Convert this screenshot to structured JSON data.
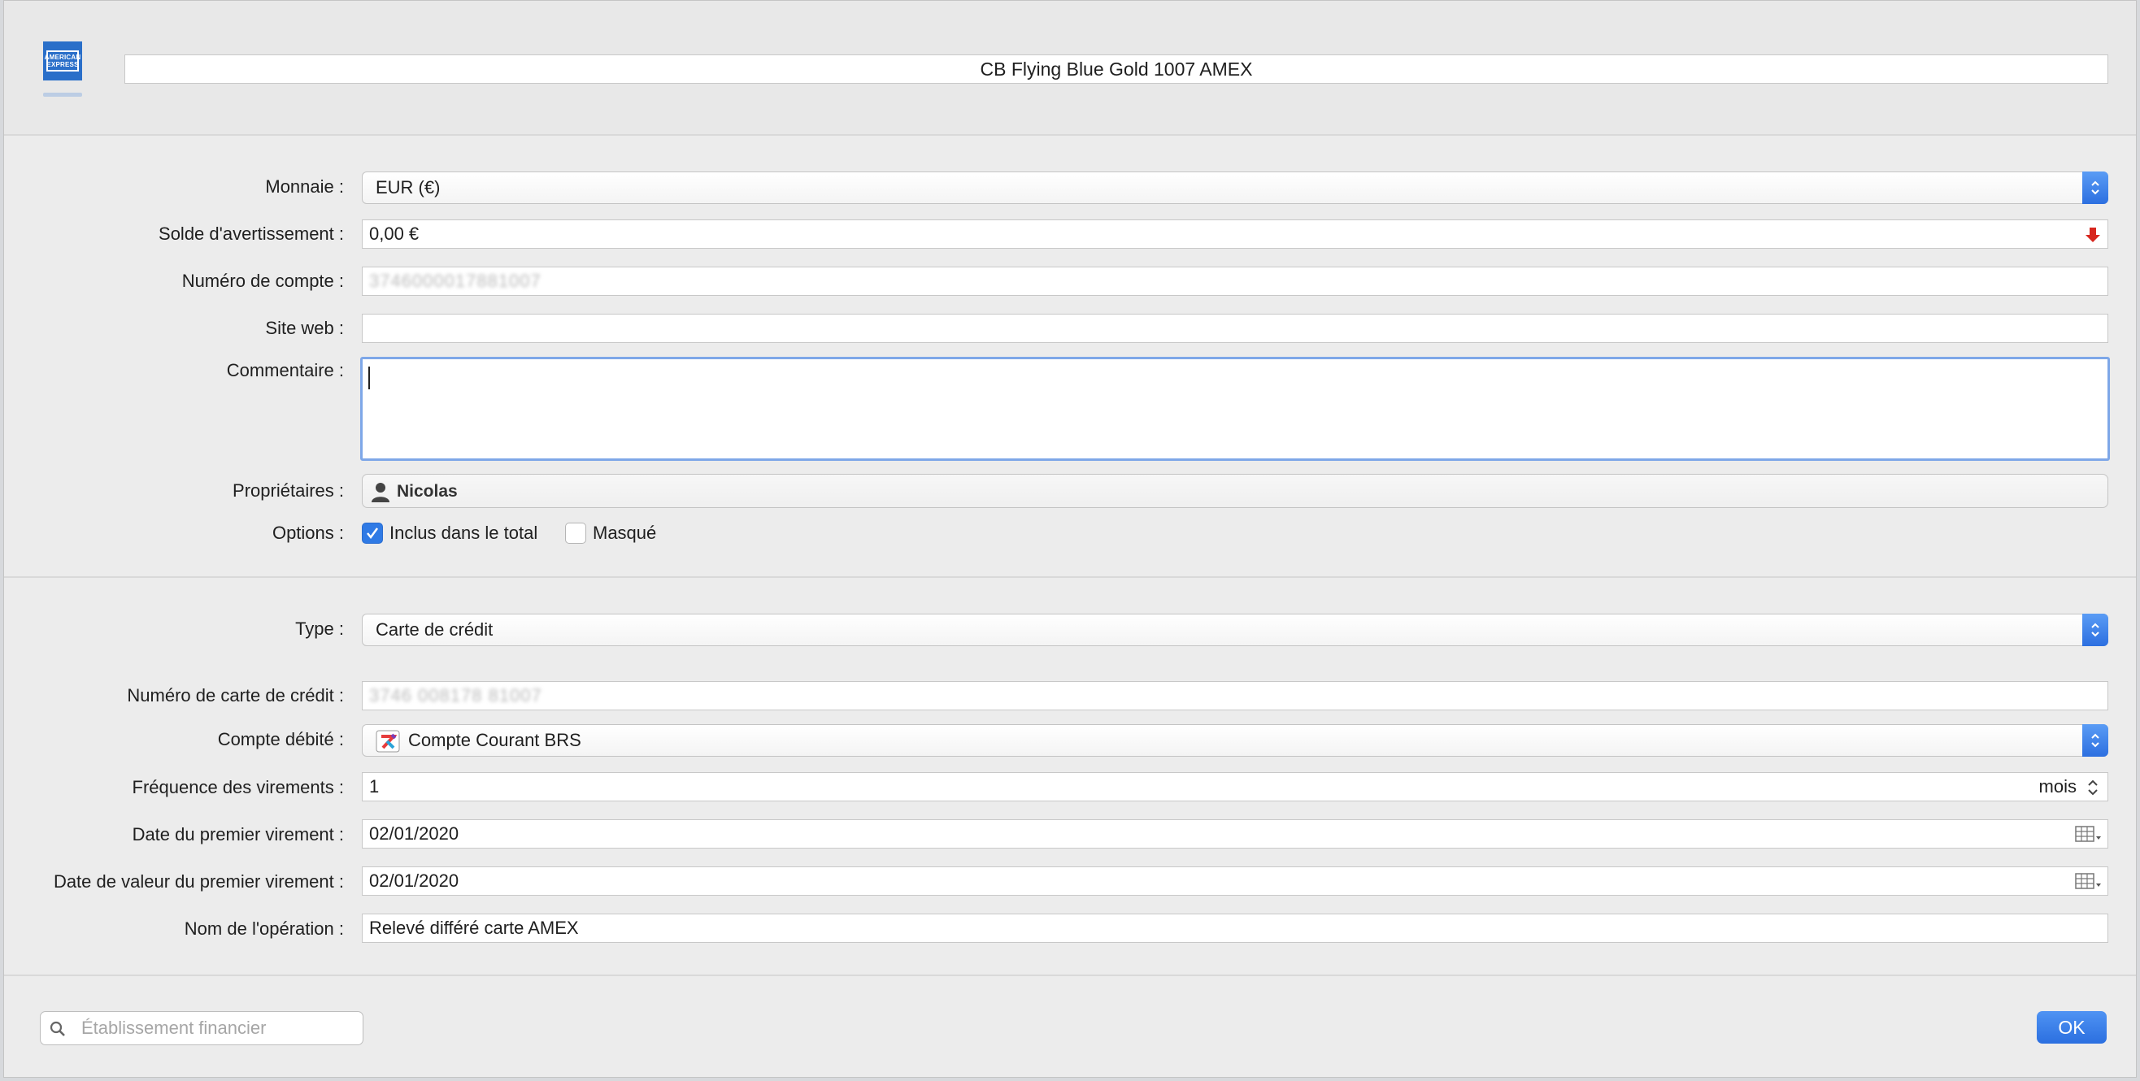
{
  "header": {
    "logo_text_line1": "AMERICAN",
    "logo_text_line2": "EXPRESS",
    "account_title": "CB Flying Blue Gold 1007 AMEX"
  },
  "general": {
    "currency_label": "Monnaie :",
    "currency_value": "EUR (€)",
    "warning_balance_label": "Solde d'avertissement :",
    "warning_balance_value": "0,00 €",
    "account_number_label": "Numéro de compte :",
    "account_number_value": "3746000017881007",
    "website_label": "Site web :",
    "website_value": "",
    "comment_label": "Commentaire :",
    "comment_value": "",
    "owners_label": "Propriétaires :",
    "owner_name": "Nicolas",
    "options_label": "Options :",
    "option_included": "Inclus dans le total",
    "option_hidden": "Masqué"
  },
  "card": {
    "type_label": "Type :",
    "type_value": "Carte de crédit",
    "card_number_label": "Numéro de carte de crédit :",
    "card_number_value": "3746 008178 81007",
    "debit_account_label": "Compte débité :",
    "debit_account_value": "Compte Courant BRS",
    "frequency_label": "Fréquence des virements :",
    "frequency_value": "1",
    "frequency_unit": "mois",
    "first_transfer_label": "Date du premier virement :",
    "first_transfer_value": "02/01/2020",
    "first_value_date_label": "Date de valeur du premier virement :",
    "first_value_date_value": "02/01/2020",
    "operation_name_label": "Nom de l'opération :",
    "operation_name_value": "Relevé différé carte AMEX"
  },
  "footer": {
    "search_placeholder": "Établissement financier",
    "ok_label": "OK"
  },
  "colors": {
    "accent": "#2f7ae5",
    "warning_arrow": "#d7261e"
  }
}
